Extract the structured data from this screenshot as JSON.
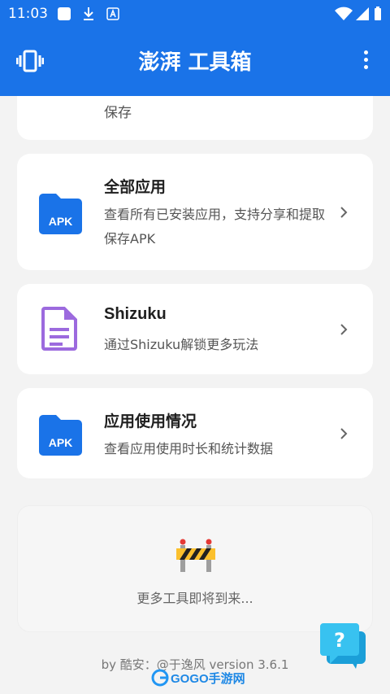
{
  "status_bar": {
    "time": "11:03",
    "icons": [
      "app-square-icon",
      "download-icon",
      "a-icon",
      "wifi-icon",
      "battery-icon"
    ]
  },
  "app_bar": {
    "title": "澎湃 工具箱",
    "left_icon": "vibrate-icon",
    "right_icon": "more-vert-icon"
  },
  "partial_card": {
    "text": "保存"
  },
  "tools": [
    {
      "title": "全部应用",
      "desc": "查看所有已安装应用，支持分享和提取保存APK",
      "icon": "apk-folder-icon",
      "icon_label": "APK"
    },
    {
      "title": "Shizuku",
      "desc": "通过Shizuku解锁更多玩法",
      "icon": "document-icon"
    },
    {
      "title": "应用使用情况",
      "desc": "查看应用使用时长和统计数据",
      "icon": "apk-folder-icon",
      "icon_label": "APK"
    }
  ],
  "coming_soon": {
    "text": "更多工具即将到来...",
    "icon": "construction-barrier-icon"
  },
  "footer": {
    "text": "by 酷安：@于逸风 version 3.6.1"
  },
  "watermark": {
    "text": "GOGO手游网"
  },
  "colors": {
    "primary": "#1a73e8",
    "apk_icon": "#1a73e8",
    "doc_icon": "#9c6ade"
  }
}
